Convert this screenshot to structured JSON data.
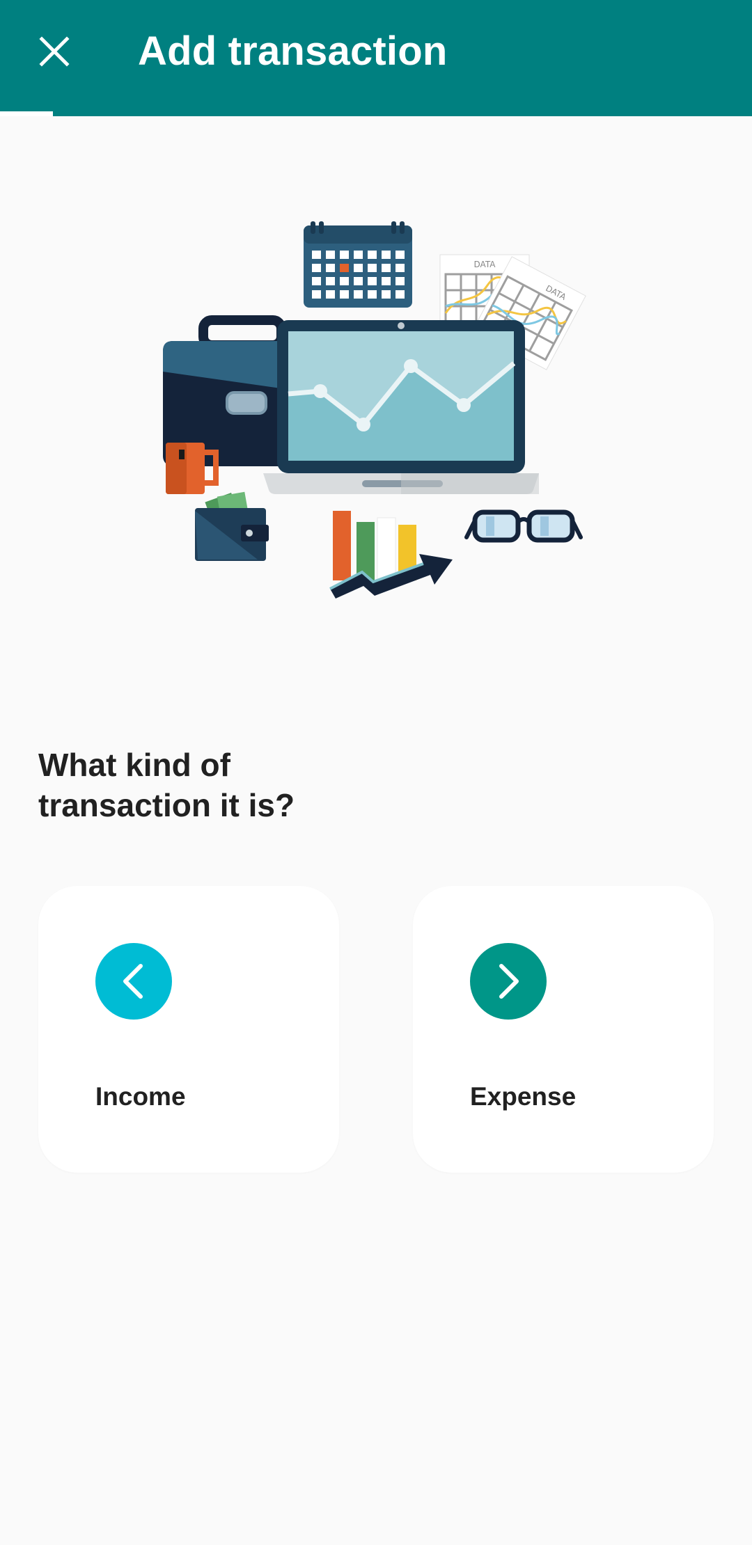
{
  "app_bar": {
    "title": "Add transaction",
    "close_icon": "close-icon",
    "background": "#008080"
  },
  "progress": {
    "fraction": 0.07
  },
  "illustration": {
    "name": "finance-workspace-illustration"
  },
  "question": "What kind of transaction it is?",
  "options": [
    {
      "label": "Income",
      "icon": "chevron-left-icon",
      "color": "#00bcd4"
    },
    {
      "label": "Expense",
      "icon": "chevron-right-icon",
      "color": "#009688"
    }
  ]
}
